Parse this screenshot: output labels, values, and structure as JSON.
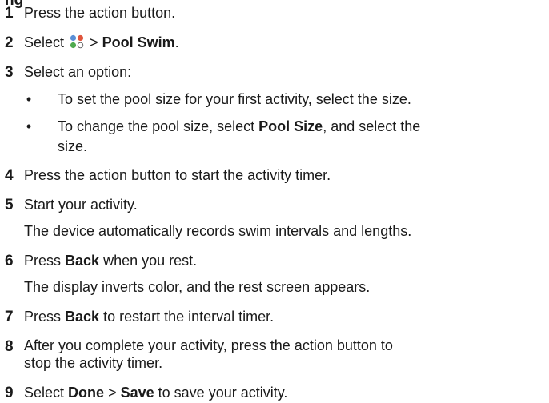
{
  "heading": "ng",
  "steps": [
    {
      "num": "1",
      "text": "Press the action button."
    },
    {
      "num": "2",
      "pre": "Select",
      "sep": ">",
      "bold": "Pool Swim",
      "post": "."
    },
    {
      "num": "3",
      "text": "Select an option:"
    },
    {
      "num": "4",
      "text": "Press the action button to start the activity timer."
    },
    {
      "num": "5",
      "text": "Start your activity."
    },
    {
      "num": "6",
      "pre": "Press",
      "bold": "Back",
      "post": "when you rest."
    },
    {
      "num": "7",
      "pre": "Press",
      "bold": "Back",
      "post": "to restart the interval timer."
    },
    {
      "num": "8",
      "line1": "After you complete your activity, press the action button to",
      "line2": "stop the activity timer."
    },
    {
      "num": "9",
      "pre": "Select",
      "bold1": "Done",
      "sep": ">",
      "bold2": "Save",
      "post": "to save your activity."
    }
  ],
  "bullets": [
    {
      "dot": "•",
      "text": "To set the pool size for your first activity, select the size."
    },
    {
      "dot": "•",
      "pre": "To change the pool size, select",
      "bold": "Pool Size",
      "post": ", and select the",
      "line2": "size."
    }
  ],
  "notes": {
    "step5": "The device automatically records swim intervals and lengths.",
    "step6": "The display inverts color, and the rest screen appears."
  },
  "icons": {
    "apps": "apps-icon",
    "colors": [
      "#5a8fd6",
      "#e0543c",
      "#4faa4f",
      "#ffffff"
    ]
  }
}
